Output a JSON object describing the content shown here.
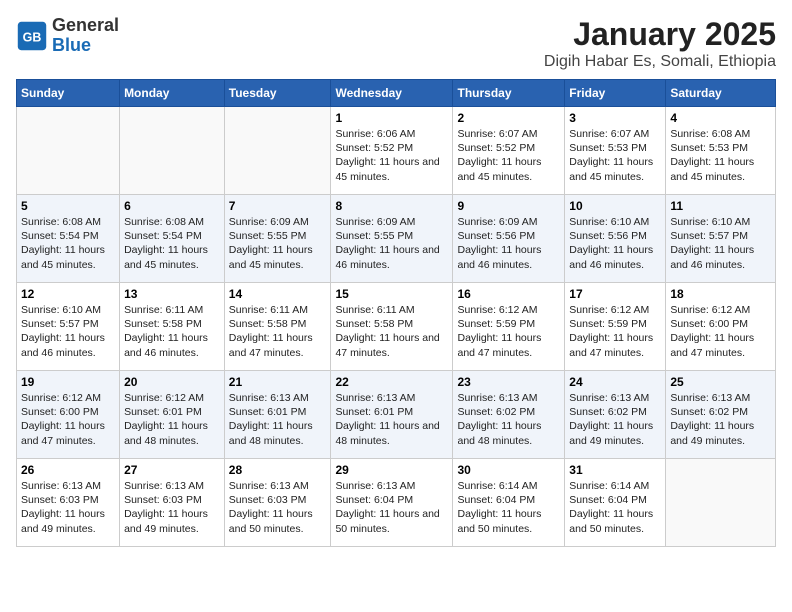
{
  "header": {
    "logo_general": "General",
    "logo_blue": "Blue",
    "title": "January 2025",
    "subtitle": "Digih Habar Es, Somali, Ethiopia"
  },
  "weekdays": [
    "Sunday",
    "Monday",
    "Tuesday",
    "Wednesday",
    "Thursday",
    "Friday",
    "Saturday"
  ],
  "weeks": [
    [
      {
        "day": "",
        "content": ""
      },
      {
        "day": "",
        "content": ""
      },
      {
        "day": "",
        "content": ""
      },
      {
        "day": "1",
        "content": "Sunrise: 6:06 AM\nSunset: 5:52 PM\nDaylight: 11 hours\nand 45 minutes."
      },
      {
        "day": "2",
        "content": "Sunrise: 6:07 AM\nSunset: 5:52 PM\nDaylight: 11 hours\nand 45 minutes."
      },
      {
        "day": "3",
        "content": "Sunrise: 6:07 AM\nSunset: 5:53 PM\nDaylight: 11 hours\nand 45 minutes."
      },
      {
        "day": "4",
        "content": "Sunrise: 6:08 AM\nSunset: 5:53 PM\nDaylight: 11 hours\nand 45 minutes."
      }
    ],
    [
      {
        "day": "5",
        "content": "Sunrise: 6:08 AM\nSunset: 5:54 PM\nDaylight: 11 hours\nand 45 minutes."
      },
      {
        "day": "6",
        "content": "Sunrise: 6:08 AM\nSunset: 5:54 PM\nDaylight: 11 hours\nand 45 minutes."
      },
      {
        "day": "7",
        "content": "Sunrise: 6:09 AM\nSunset: 5:55 PM\nDaylight: 11 hours\nand 45 minutes."
      },
      {
        "day": "8",
        "content": "Sunrise: 6:09 AM\nSunset: 5:55 PM\nDaylight: 11 hours\nand 46 minutes."
      },
      {
        "day": "9",
        "content": "Sunrise: 6:09 AM\nSunset: 5:56 PM\nDaylight: 11 hours\nand 46 minutes."
      },
      {
        "day": "10",
        "content": "Sunrise: 6:10 AM\nSunset: 5:56 PM\nDaylight: 11 hours\nand 46 minutes."
      },
      {
        "day": "11",
        "content": "Sunrise: 6:10 AM\nSunset: 5:57 PM\nDaylight: 11 hours\nand 46 minutes."
      }
    ],
    [
      {
        "day": "12",
        "content": "Sunrise: 6:10 AM\nSunset: 5:57 PM\nDaylight: 11 hours\nand 46 minutes."
      },
      {
        "day": "13",
        "content": "Sunrise: 6:11 AM\nSunset: 5:58 PM\nDaylight: 11 hours\nand 46 minutes."
      },
      {
        "day": "14",
        "content": "Sunrise: 6:11 AM\nSunset: 5:58 PM\nDaylight: 11 hours\nand 47 minutes."
      },
      {
        "day": "15",
        "content": "Sunrise: 6:11 AM\nSunset: 5:58 PM\nDaylight: 11 hours\nand 47 minutes."
      },
      {
        "day": "16",
        "content": "Sunrise: 6:12 AM\nSunset: 5:59 PM\nDaylight: 11 hours\nand 47 minutes."
      },
      {
        "day": "17",
        "content": "Sunrise: 6:12 AM\nSunset: 5:59 PM\nDaylight: 11 hours\nand 47 minutes."
      },
      {
        "day": "18",
        "content": "Sunrise: 6:12 AM\nSunset: 6:00 PM\nDaylight: 11 hours\nand 47 minutes."
      }
    ],
    [
      {
        "day": "19",
        "content": "Sunrise: 6:12 AM\nSunset: 6:00 PM\nDaylight: 11 hours\nand 47 minutes."
      },
      {
        "day": "20",
        "content": "Sunrise: 6:12 AM\nSunset: 6:01 PM\nDaylight: 11 hours\nand 48 minutes."
      },
      {
        "day": "21",
        "content": "Sunrise: 6:13 AM\nSunset: 6:01 PM\nDaylight: 11 hours\nand 48 minutes."
      },
      {
        "day": "22",
        "content": "Sunrise: 6:13 AM\nSunset: 6:01 PM\nDaylight: 11 hours\nand 48 minutes."
      },
      {
        "day": "23",
        "content": "Sunrise: 6:13 AM\nSunset: 6:02 PM\nDaylight: 11 hours\nand 48 minutes."
      },
      {
        "day": "24",
        "content": "Sunrise: 6:13 AM\nSunset: 6:02 PM\nDaylight: 11 hours\nand 49 minutes."
      },
      {
        "day": "25",
        "content": "Sunrise: 6:13 AM\nSunset: 6:02 PM\nDaylight: 11 hours\nand 49 minutes."
      }
    ],
    [
      {
        "day": "26",
        "content": "Sunrise: 6:13 AM\nSunset: 6:03 PM\nDaylight: 11 hours\nand 49 minutes."
      },
      {
        "day": "27",
        "content": "Sunrise: 6:13 AM\nSunset: 6:03 PM\nDaylight: 11 hours\nand 49 minutes."
      },
      {
        "day": "28",
        "content": "Sunrise: 6:13 AM\nSunset: 6:03 PM\nDaylight: 11 hours\nand 50 minutes."
      },
      {
        "day": "29",
        "content": "Sunrise: 6:13 AM\nSunset: 6:04 PM\nDaylight: 11 hours\nand 50 minutes."
      },
      {
        "day": "30",
        "content": "Sunrise: 6:14 AM\nSunset: 6:04 PM\nDaylight: 11 hours\nand 50 minutes."
      },
      {
        "day": "31",
        "content": "Sunrise: 6:14 AM\nSunset: 6:04 PM\nDaylight: 11 hours\nand 50 minutes."
      },
      {
        "day": "",
        "content": ""
      }
    ]
  ]
}
